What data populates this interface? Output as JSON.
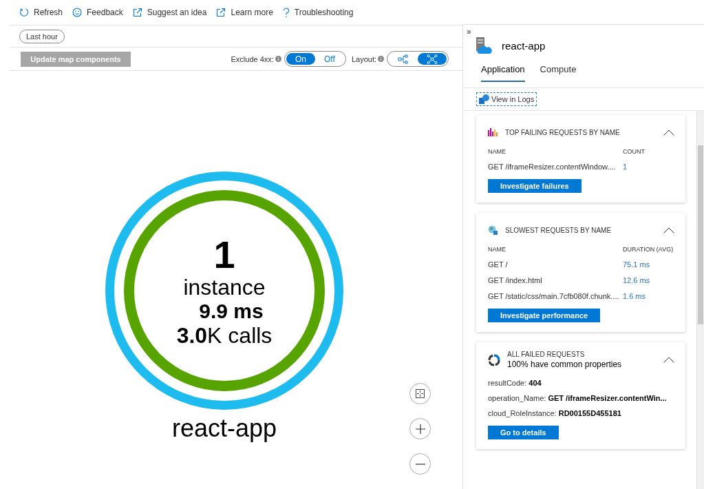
{
  "toolbar": [
    {
      "kind": "refresh",
      "label": "Refresh"
    },
    {
      "kind": "smile",
      "label": "Feedback"
    },
    {
      "kind": "external",
      "label": "Suggest an idea"
    },
    {
      "kind": "external",
      "label": "Learn more"
    },
    {
      "kind": "help",
      "label": "Troubleshooting"
    }
  ],
  "time_range": "Last hour",
  "update_button": {
    "label": "Update map components",
    "disabled": true
  },
  "exclude_4xx": {
    "label": "Exclude 4xx:",
    "options": [
      {
        "label": "On",
        "selected": true
      },
      {
        "label": "Off",
        "selected": false
      }
    ]
  },
  "layout": {
    "label": "Layout:",
    "options": [
      {
        "kind": "hierarchical",
        "selected": false
      },
      {
        "kind": "radial",
        "selected": true
      }
    ]
  },
  "node": {
    "count": "1",
    "unit": "instance",
    "duration": "9.9 ms",
    "calls": "**3.0**K calls",
    "name": "react-app"
  },
  "panel": {
    "collapse": "»",
    "title": "react-app",
    "tabs": [
      {
        "label": "Application",
        "selected": true
      },
      {
        "label": "Compute",
        "selected": false
      }
    ],
    "view_logs": "View in Logs",
    "cards": [
      {
        "kind": "table",
        "title": "TOP FAILING REQUESTS BY NAME",
        "columns": [
          "NAME",
          "COUNT"
        ],
        "rows": [
          [
            "GET /iframeResizer.contentWindow....",
            "1"
          ]
        ],
        "button": "Investigate failures"
      },
      {
        "kind": "table",
        "title": "SLOWEST REQUESTS BY NAME",
        "columns": [
          "NAME",
          "DURATION (AVG)"
        ],
        "rows": [
          [
            "GET /",
            "75.1 ms"
          ],
          [
            "GET /index.html",
            "12.6 ms"
          ],
          [
            "GET /static/css/main.7cfb080f.chunk....",
            "1.6 ms"
          ]
        ],
        "button": "Investigate performance"
      },
      {
        "kind": "properties",
        "title": "ALL FAILED REQUESTS",
        "subtitle": "100% have common properties",
        "properties": [
          {
            "key": "resultCode: ",
            "value": "404"
          },
          {
            "key": "operation_Name: ",
            "value": "GET /iframeResizer.contentWin..."
          },
          {
            "key": "cloud_RoleInstance: ",
            "value": "RD00155D455181"
          }
        ],
        "button": "Go to details"
      }
    ]
  }
}
